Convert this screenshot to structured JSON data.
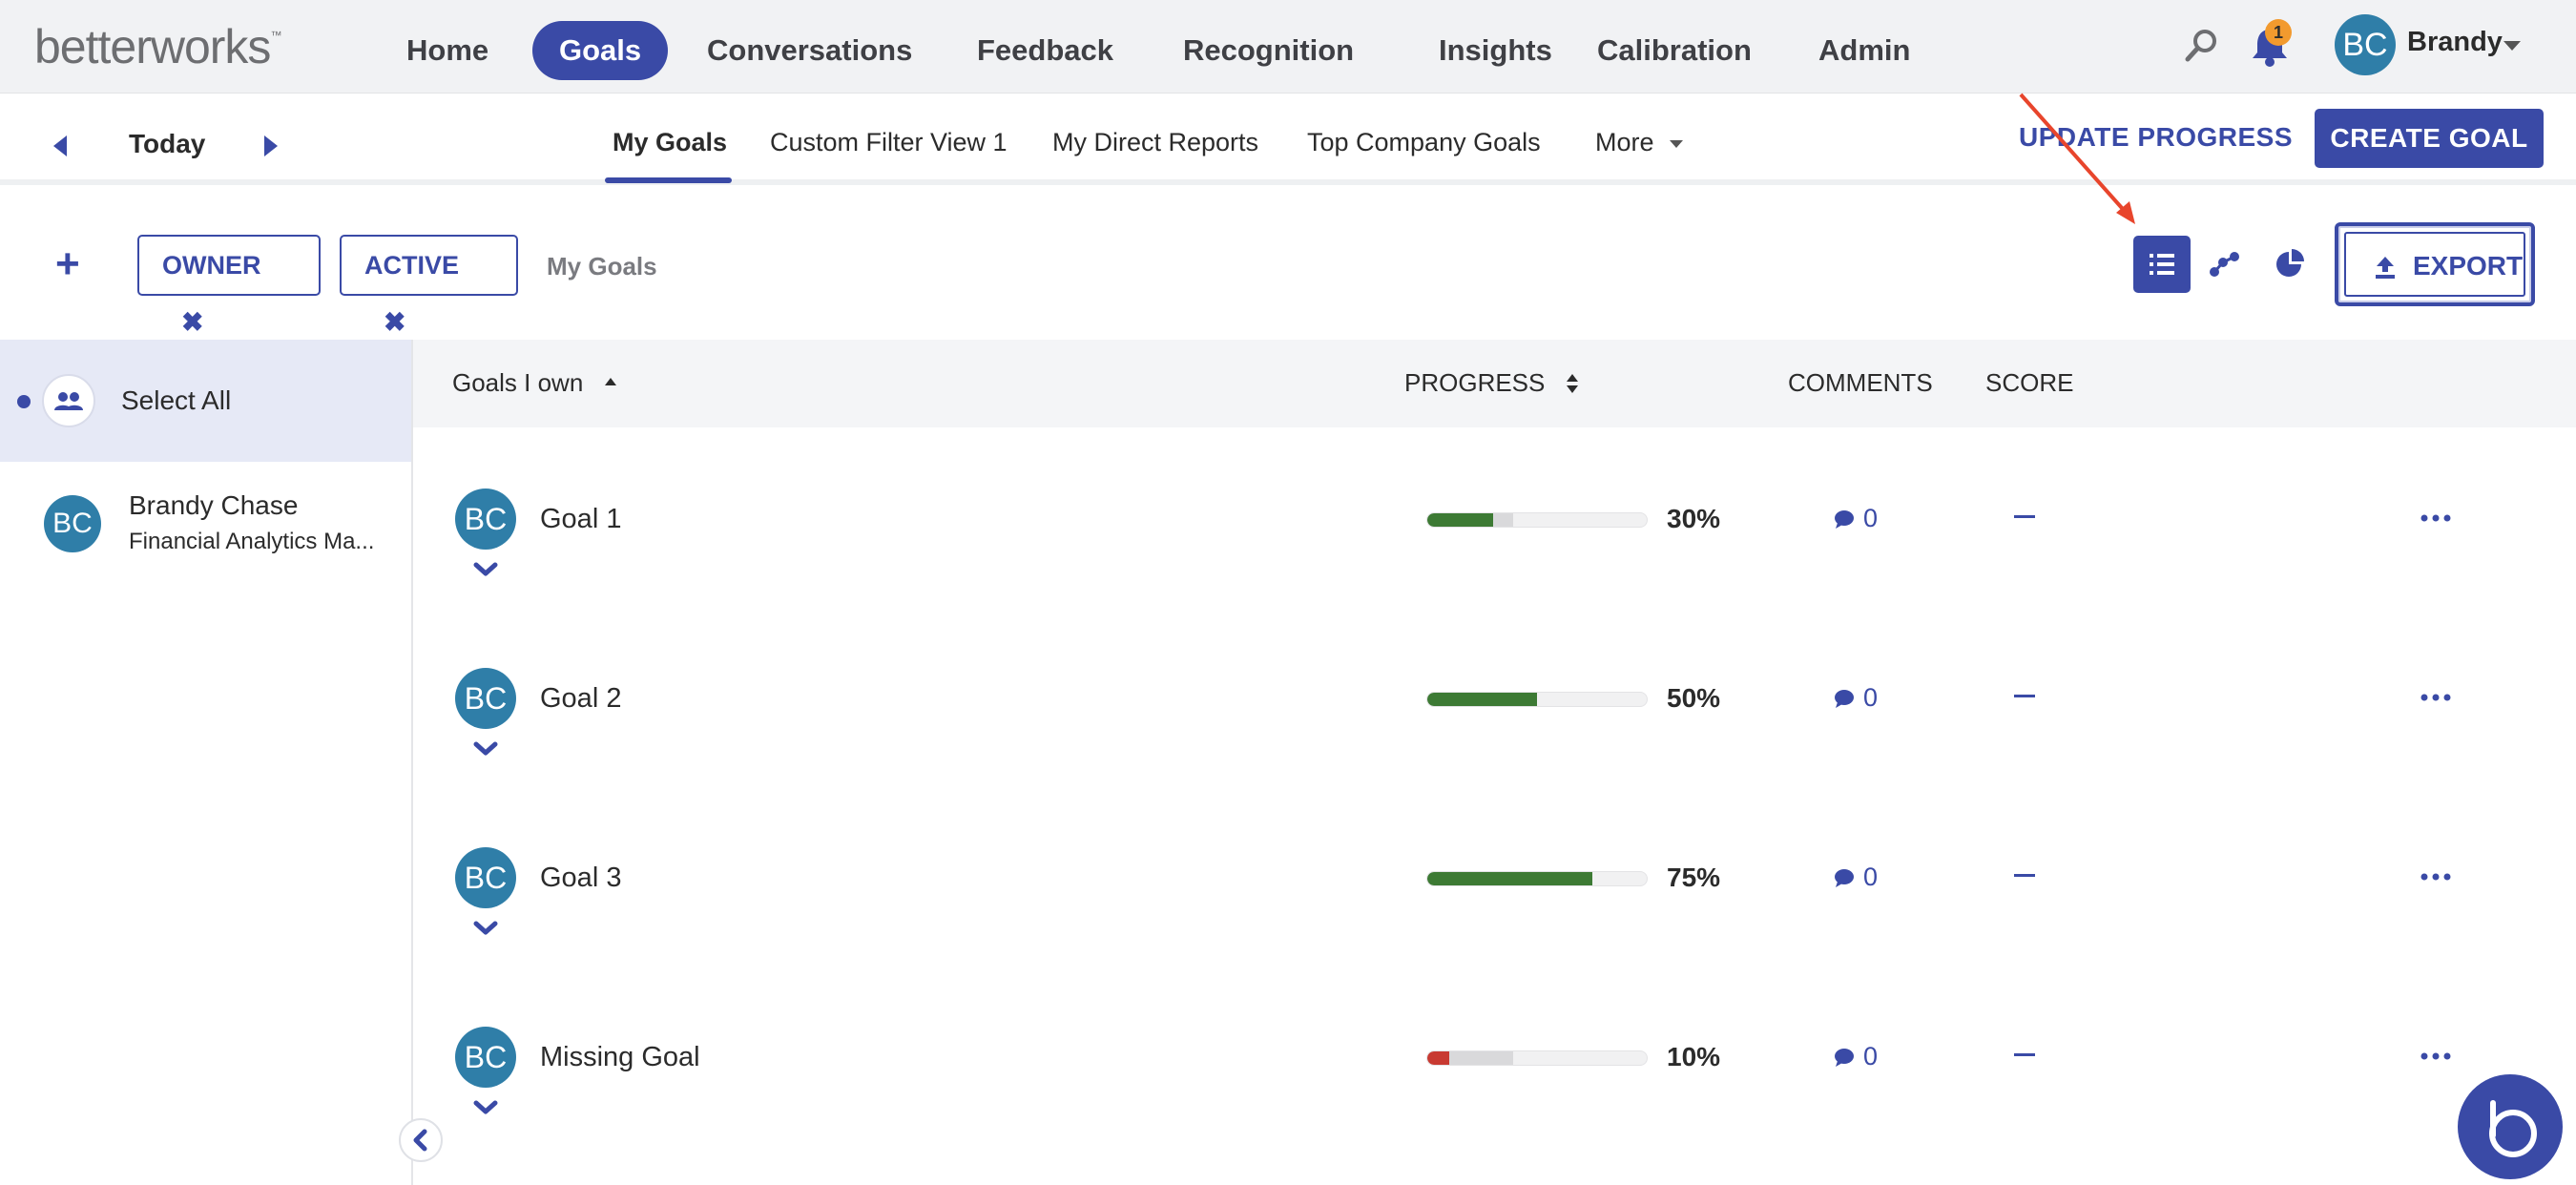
{
  "brand": {
    "logo_text": "betterworks",
    "logo_mark": "™",
    "accent": "#3a4aa6"
  },
  "topnav": {
    "items": [
      {
        "label": "Home"
      },
      {
        "label": "Goals",
        "active": true
      },
      {
        "label": "Conversations"
      },
      {
        "label": "Feedback"
      },
      {
        "label": "Recognition"
      },
      {
        "label": "Insights"
      },
      {
        "label": "Calibration"
      },
      {
        "label": "Admin"
      }
    ],
    "notification_count": "1",
    "user": {
      "initials": "BC",
      "name": "Brandy"
    }
  },
  "subnav": {
    "date_label": "Today",
    "tabs": [
      {
        "label": "My Goals",
        "active": true
      },
      {
        "label": "Custom Filter View 1"
      },
      {
        "label": "My Direct Reports"
      },
      {
        "label": "Top Company Goals"
      },
      {
        "label": "More"
      }
    ],
    "update_progress_label": "UPDATE PROGRESS",
    "create_goal_label": "CREATE GOAL"
  },
  "filters": {
    "add_icon": "plus-icon",
    "chips": [
      {
        "label": "OWNER"
      },
      {
        "label": "ACTIVE"
      }
    ],
    "current_view": "My Goals",
    "export_label": "EXPORT"
  },
  "left_panel": {
    "select_all_label": "Select All",
    "people": [
      {
        "initials": "BC",
        "name": "Brandy Chase",
        "title": "Financial Analytics Ma..."
      }
    ]
  },
  "table": {
    "headers": {
      "title": "Goals I own",
      "progress": "PROGRESS",
      "comments": "COMMENTS",
      "score": "SCORE"
    },
    "rows": [
      {
        "initials": "BC",
        "title": "Goal 1",
        "progress": 30,
        "progress_label": "30%",
        "status_color": "#3d7a34",
        "comments": "0",
        "score": "—"
      },
      {
        "initials": "BC",
        "title": "Goal 2",
        "progress": 50,
        "progress_label": "50%",
        "status_color": "#3d7a34",
        "comments": "0",
        "score": "—"
      },
      {
        "initials": "BC",
        "title": "Goal 3",
        "progress": 75,
        "progress_label": "75%",
        "status_color": "#3d7a34",
        "comments": "0",
        "score": "—"
      },
      {
        "initials": "BC",
        "title": "Missing Goal",
        "progress": 10,
        "progress_label": "10%",
        "status_color": "#c83a32",
        "comments": "0",
        "score": "—"
      }
    ]
  }
}
